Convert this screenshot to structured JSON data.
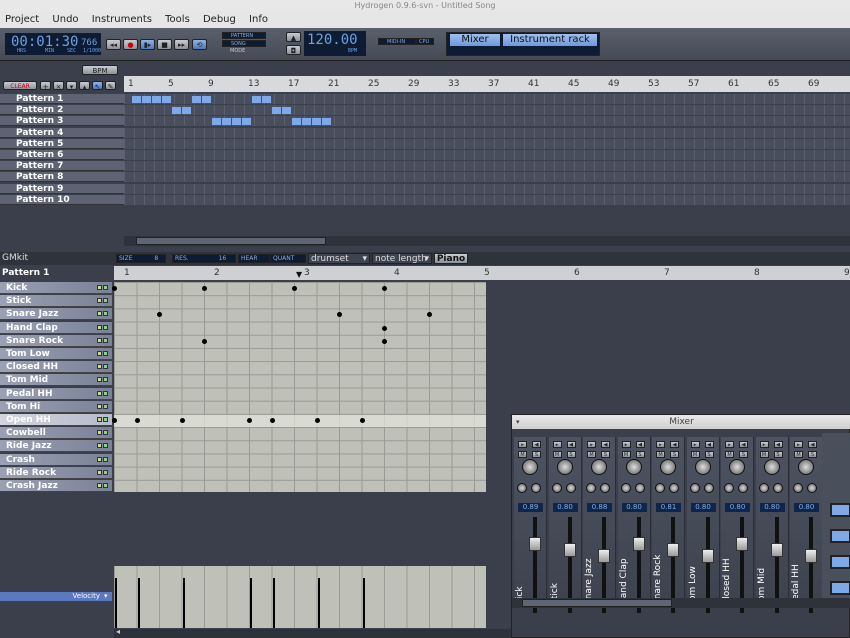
{
  "window_title": "Hydrogen 0.9.6-svn - Untitled Song",
  "menu": [
    "Project",
    "Undo",
    "Instruments",
    "Tools",
    "Debug",
    "Info"
  ],
  "transport": {
    "time": "00:01:30",
    "ms": "766",
    "units": [
      "HRS",
      "MIN",
      "SEC",
      "1/1000"
    ],
    "bpm": "120.00",
    "bpm_label": "BPM",
    "midi": "MIDI-IN",
    "cpu": "CPU"
  },
  "mode": {
    "pattern": "PATTERN",
    "song": "SONG",
    "mode": "MODE"
  },
  "panel_tabs": [
    "Mixer",
    "Instrument rack"
  ],
  "song_editor": {
    "bpm_button": "BPM",
    "clear": "CLEAR",
    "bars": [
      "1",
      "5",
      "9",
      "13",
      "17",
      "21",
      "25",
      "29",
      "33",
      "37",
      "41",
      "45",
      "49",
      "53",
      "57",
      "61",
      "65",
      "69"
    ],
    "patterns": [
      "Pattern 1",
      "Pattern 2",
      "Pattern 3",
      "Pattern 4",
      "Pattern 5",
      "Pattern 6",
      "Pattern 7",
      "Pattern 8",
      "Pattern 9",
      "Pattern 10"
    ]
  },
  "pattern_editor": {
    "kit": "GMkit",
    "pattern": "Pattern 1",
    "size_label": "SIZE",
    "size": "8",
    "res_label": "RES.",
    "res": "16",
    "hear": "HEAR",
    "quant": "QUANT",
    "drumset": "drumset",
    "note_length": "note length",
    "piano": "Piano",
    "beats": [
      "1",
      "2",
      "3",
      "4",
      "5",
      "6",
      "7",
      "8",
      "9"
    ],
    "instruments": [
      "Kick",
      "Stick",
      "Snare Jazz",
      "Hand Clap",
      "Snare Rock",
      "Tom Low",
      "Closed HH",
      "Tom Mid",
      "Pedal HH",
      "Tom Hi",
      "Open HH",
      "Cowbell",
      "Ride Jazz",
      "Crash",
      "Ride Rock",
      "Crash Jazz"
    ],
    "selected": "Open HH",
    "velocity": "Velocity"
  },
  "mixer": {
    "title": "Mixer",
    "channels": [
      {
        "name": "Kick",
        "value": "0.89"
      },
      {
        "name": "Stick",
        "value": "0.80"
      },
      {
        "name": "Snare Jazz",
        "value": "0.88"
      },
      {
        "name": "Hand Clap",
        "value": "0.80"
      },
      {
        "name": "Snare Rock",
        "value": "0.81"
      },
      {
        "name": "Tom Low",
        "value": "0.80"
      },
      {
        "name": "Closed HH",
        "value": "0.80"
      },
      {
        "name": "Tom Mid",
        "value": "0.80"
      },
      {
        "name": "Pedal HH",
        "value": "0.80"
      }
    ]
  }
}
